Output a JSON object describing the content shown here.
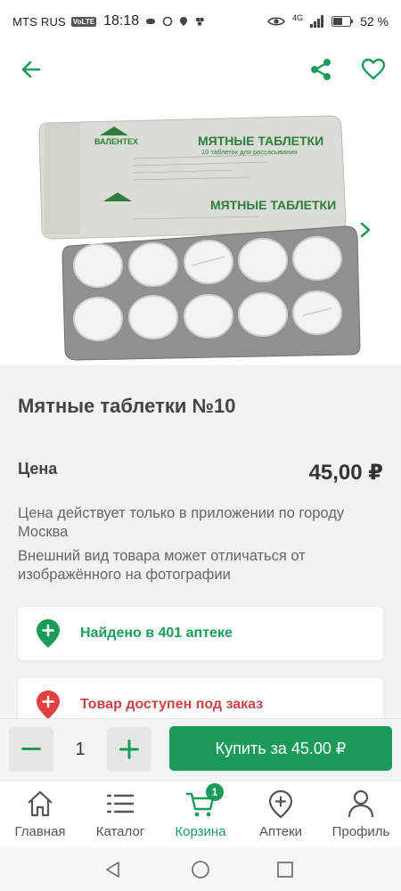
{
  "status_bar": {
    "carrier": "MTS RUS",
    "volte": "VoLTE",
    "time": "18:18",
    "network": "4G",
    "battery": "52 %"
  },
  "header": {
    "back_icon": "arrow-left-icon",
    "share_icon": "share-icon",
    "favorite_icon": "heart-icon"
  },
  "product": {
    "title": "Мятные таблетки №10",
    "price_label": "Цена",
    "price": "45,00 ₽",
    "note_app_only": "Цена действует только в приложении по городу Москва",
    "note_appearance": "Внешний вид товара может отличаться от изображённого на фотографии",
    "image": {
      "brand": "ВАЛЕНТЕХ",
      "label": "МЯТНЫЕ ТАБЛЕТКИ",
      "sublabel": "10 таблеток для рассасывания",
      "tablet_count": 10
    }
  },
  "availability": {
    "found_text": "Найдено в 401 аптеке",
    "order_text": "Товар доступен под заказ"
  },
  "buy_panel": {
    "quantity": "1",
    "buy_label": "Купить за 45.00 ₽"
  },
  "tabs": [
    {
      "label": "Главная",
      "icon": "home-icon"
    },
    {
      "label": "Каталог",
      "icon": "list-icon"
    },
    {
      "label": "Корзина",
      "icon": "cart-icon",
      "badge": "1"
    },
    {
      "label": "Аптеки",
      "icon": "location-plus-icon"
    },
    {
      "label": "Профиль",
      "icon": "user-icon"
    }
  ],
  "colors": {
    "accent": "#1a9b5b",
    "danger": "#e04040",
    "danger_text": "#c94444"
  }
}
